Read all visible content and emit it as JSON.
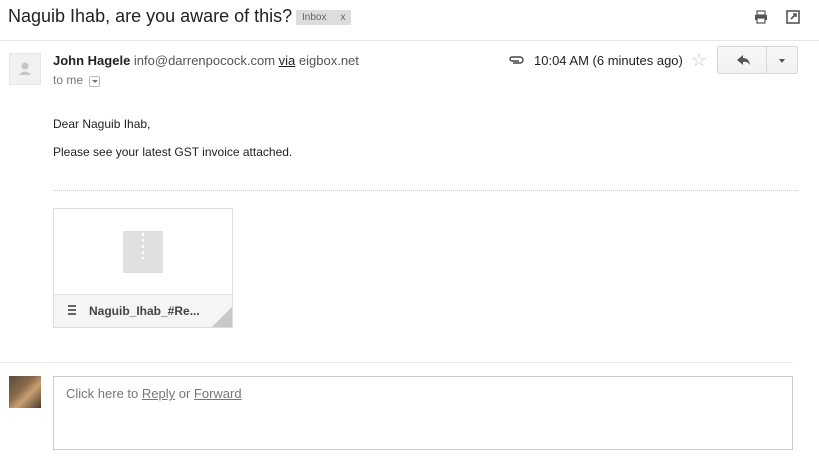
{
  "subject": "Naguib Ihab, are you aware of this?",
  "label": {
    "name": "Inbox",
    "remove": "x"
  },
  "toolbar": {
    "print_icon": "print-icon",
    "newwindow_icon": "open-in-new-window-icon"
  },
  "message": {
    "sender_name": "John Hagele",
    "sender_email": "info@darrenpocock.com",
    "via_label": "via",
    "via_domain": "eigbox.net",
    "recipient": "to me",
    "time": "10:04 AM (6 minutes ago)",
    "greeting": "Dear Naguib Ihab,",
    "body": "Please see your latest GST invoice attached."
  },
  "attachment": {
    "filename": "Naguib_Ihab_#Re..."
  },
  "reply": {
    "prefix": "Click here to ",
    "reply_link": "Reply",
    "or": " or ",
    "forward_link": "Forward"
  },
  "colors": {
    "label_bg": "#dddddd",
    "divider": "#e5e5e5",
    "star": "#c6c6c6"
  }
}
